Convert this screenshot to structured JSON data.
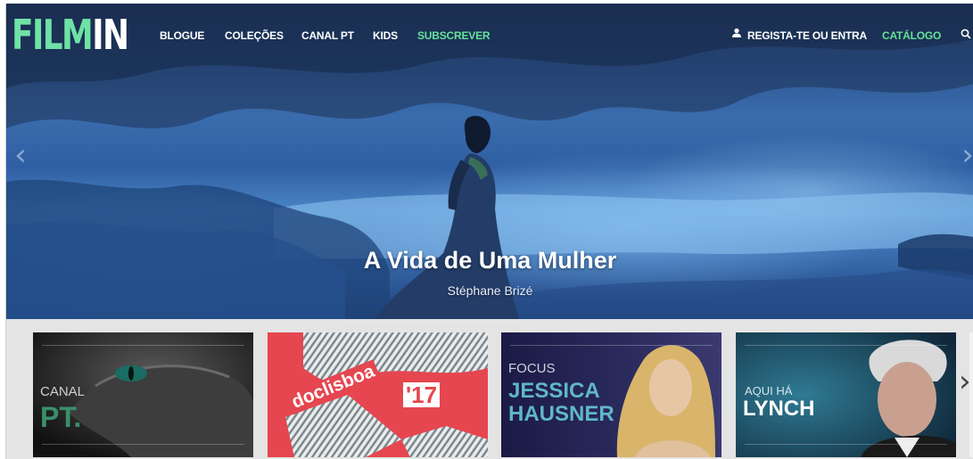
{
  "logo": {
    "part1": "FILM",
    "part2": "IN"
  },
  "nav": {
    "links": [
      "BLOGUE",
      "COLEÇÕES",
      "CANAL PT",
      "KIDS",
      "SUBSCREVER"
    ],
    "account": "REGISTA-TE OU ENTRA",
    "catalog": "CATÁLOGO"
  },
  "hero": {
    "title": "A Vida de Uma Mulher",
    "subtitle": "Stéphane Brizé",
    "prev_arrow": "‹",
    "next_arrow": "›"
  },
  "cards": [
    {
      "line1": "CANAL",
      "line2": "PT."
    },
    {
      "line1": "doclisboa",
      "line2": "'17"
    },
    {
      "line1": "FOCUS",
      "line2": "JESSICA",
      "line3": "HAUSNER"
    },
    {
      "line1": "AQUI HÁ",
      "line2": "LYNCH"
    }
  ],
  "cards_next_arrow": "›",
  "colors": {
    "brand_green": "#6fe2a6",
    "accent_green": "#66e39a",
    "doclisboa_red": "#e5464f"
  }
}
